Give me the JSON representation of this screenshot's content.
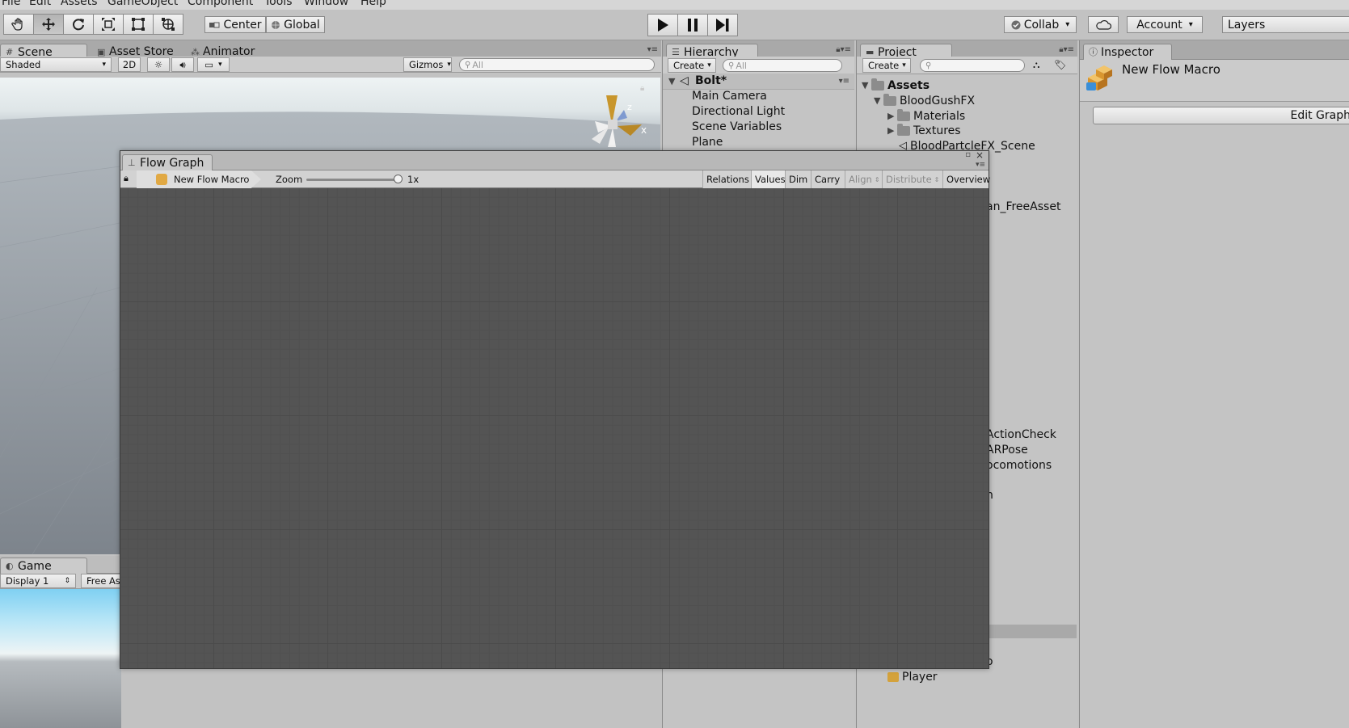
{
  "menu": [
    "File",
    "Edit",
    "Assets",
    "GameObject",
    "Component",
    "Tools",
    "Window",
    "Help"
  ],
  "toolbar": {
    "pivot_label": "Center",
    "space_label": "Global",
    "collab_label": "Collab",
    "account_label": "Account",
    "layers_label": "Layers"
  },
  "scene": {
    "tabs": [
      "Scene",
      "Asset Store",
      "Animator"
    ],
    "shading_mode": "Shaded",
    "mode_2d": "2D",
    "gizmos_label": "Gizmos",
    "search_placeholder": "All",
    "gizmo_axes": {
      "z": "z",
      "x": "x"
    }
  },
  "game": {
    "tab": "Game",
    "display": "Display 1",
    "aspect": "Free As"
  },
  "hierarchy": {
    "tab": "Hierarchy",
    "create_label": "Create",
    "search_placeholder": "All",
    "scene_name": "Bolt*",
    "items": [
      "Main Camera",
      "Directional Light",
      "Scene Variables",
      "Plane"
    ]
  },
  "project": {
    "tab": "Project",
    "create_label": "Create",
    "root": "Assets",
    "folder": "BloodGushFX",
    "subfolders": [
      "Materials",
      "Textures"
    ],
    "scene_item": "BloodPartcleFX_Scene",
    "partial_items": [
      "an_FreeAsset",
      "ActionCheck",
      "ARPose",
      "ocomotions",
      "n",
      "o"
    ],
    "bottom_item": "Player"
  },
  "inspector": {
    "tab": "Inspector",
    "object_name": "New Flow Macro",
    "edit_button": "Edit Graph"
  },
  "flow_graph": {
    "tab": "Flow Graph",
    "breadcrumb": "New Flow Macro",
    "zoom_label": "Zoom",
    "zoom_value_text": "1x",
    "zoom_level": 1.0,
    "tools": [
      "Relations",
      "Values",
      "Dim",
      "Carry",
      "Align",
      "Distribute",
      "Overview"
    ]
  }
}
